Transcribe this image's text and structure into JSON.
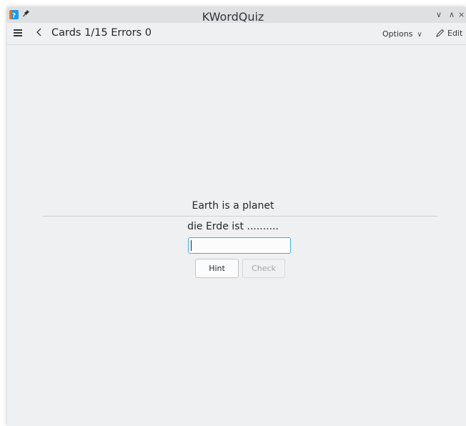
{
  "window": {
    "title": "KWordQuiz",
    "controls": {
      "minimize": "∨",
      "maximize": "∧",
      "close": "×"
    }
  },
  "toolbar": {
    "page_title": "Cards 1/15 Errors 0",
    "options_label": "Options",
    "edit_label": "Edit"
  },
  "card": {
    "question": "Earth is a planet",
    "prompt": "die Erde ist ..........",
    "answer_value": "",
    "hint_label": "Hint",
    "check_label": "Check"
  },
  "colors": {
    "focus_accent": "#3daee9",
    "window_bg": "#eff0f1"
  }
}
